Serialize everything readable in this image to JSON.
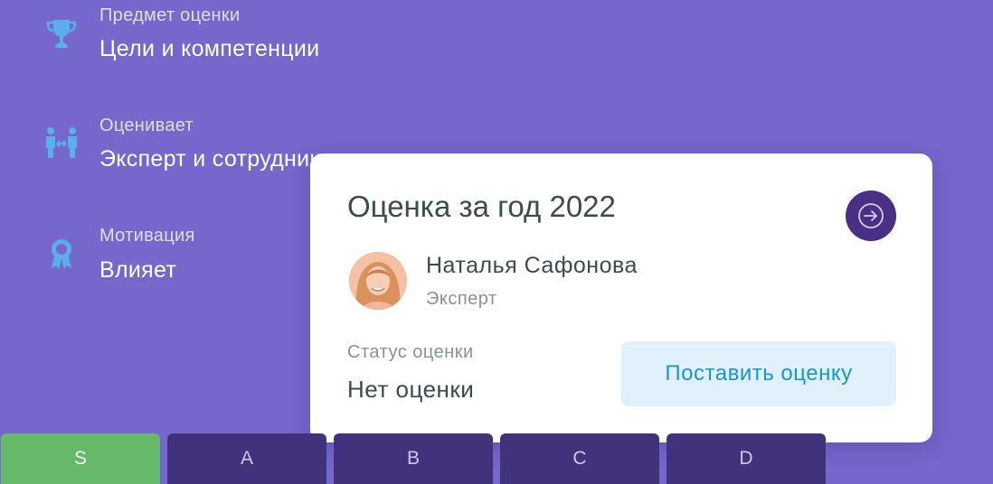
{
  "details": {
    "subject": {
      "label": "Предмет оценки",
      "value": "Цели и компетенции",
      "icon": "trophy-icon"
    },
    "evaluator": {
      "label": "Оценивает",
      "value": "Эксперт и сотрудник",
      "icon": "people-exchange-icon"
    },
    "motivation": {
      "label": "Мотивация",
      "value": "Влияет",
      "icon": "award-ribbon-icon"
    }
  },
  "card": {
    "title": "Оценка за год 2022",
    "person": {
      "name": "Наталья Сафонова",
      "role": "Эксперт"
    },
    "status": {
      "label": "Статус оценки",
      "value": "Нет оценки"
    },
    "action_label": "Поставить оценку",
    "open_icon": "arrow-right-circle-icon"
  },
  "grades": [
    {
      "label": "S",
      "active": true
    },
    {
      "label": "A",
      "active": false
    },
    {
      "label": "B",
      "active": false
    },
    {
      "label": "C",
      "active": false
    },
    {
      "label": "D",
      "active": false
    }
  ],
  "colors": {
    "background": "#7567cb",
    "icon_blue": "#5aaee9",
    "button_dark": "#4a2f86",
    "grade_active": "#67b96a",
    "grade_inactive": "#42327c",
    "action_text": "#1796d6",
    "action_bg": "#e0f1fb"
  }
}
